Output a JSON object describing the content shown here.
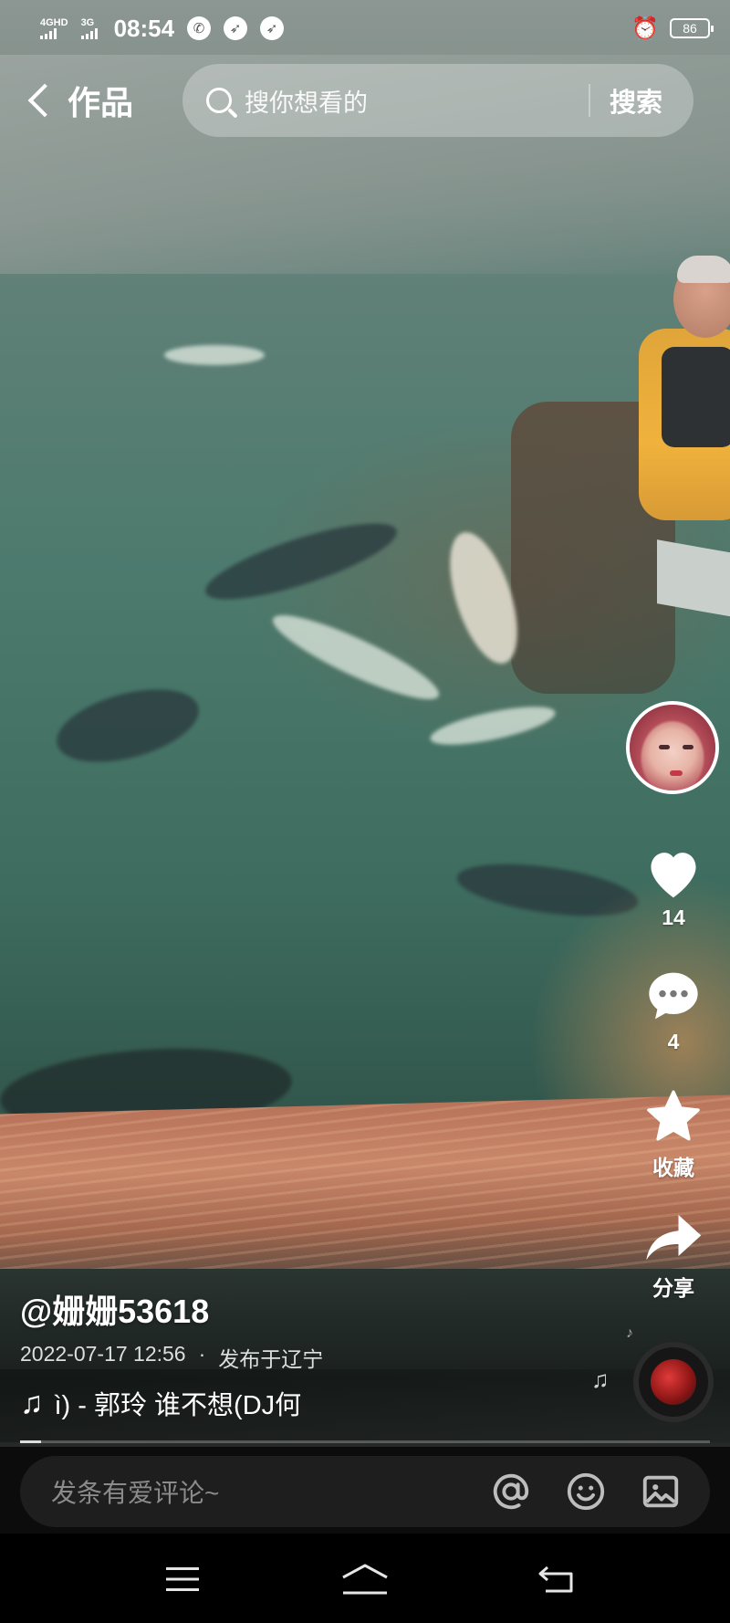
{
  "status_bar": {
    "network_1": "4GHD",
    "network_2": "3G",
    "time": "08:54",
    "battery": "86"
  },
  "top_bar": {
    "back_label": "作品",
    "search_placeholder": "搜你想看的",
    "search_button": "搜索"
  },
  "actions": {
    "like_count": "14",
    "comment_count": "4",
    "favorite_label": "收藏",
    "share_label": "分享"
  },
  "video_info": {
    "author": "@姗姗53618",
    "date": "2022-07-17 12:56",
    "separator": "·",
    "location": "发布于辽宁",
    "music": "ì) - 郭玲    谁不想(DJ何",
    "progress": 0.03
  },
  "comment_bar": {
    "placeholder": "发条有爱评论~"
  },
  "icons": {
    "back": "chevron-left-icon",
    "search": "search-icon",
    "like": "heart-icon",
    "comment": "comment-icon",
    "favorite": "star-icon",
    "share": "share-icon",
    "music": "music-note-icon",
    "mention": "at-icon",
    "emoji": "emoji-icon",
    "image": "image-icon"
  }
}
